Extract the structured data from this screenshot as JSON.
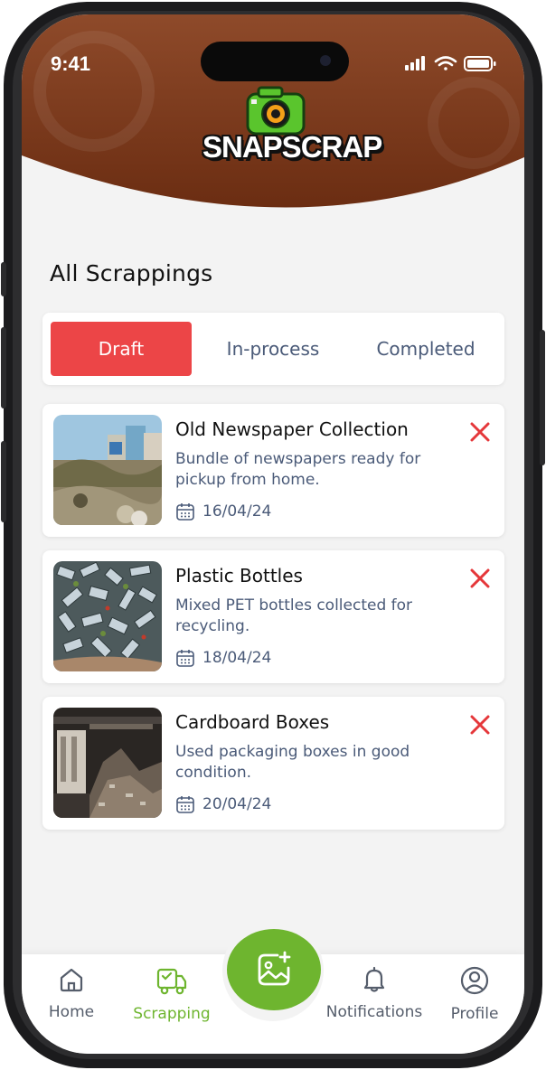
{
  "status_bar": {
    "time": "9:41"
  },
  "brand": {
    "logo_text": "SNAPSCRAP"
  },
  "page": {
    "title": "All Scrappings"
  },
  "tabs": [
    {
      "label": "Draft",
      "active": true
    },
    {
      "label": "In-process",
      "active": false
    },
    {
      "label": "Completed",
      "active": false
    }
  ],
  "scrappings": [
    {
      "title": "Old Newspaper Collection",
      "description": "Bundle of newspapers ready for pickup from home.",
      "date": "16/04/24"
    },
    {
      "title": "Plastic Bottles",
      "description": "Mixed PET bottles collected for recycling.",
      "date": "18/04/24"
    },
    {
      "title": "Cardboard Boxes",
      "description": "Used packaging boxes in good condition.",
      "date": "20/04/24"
    }
  ],
  "bottom_nav": [
    {
      "label": "Home",
      "icon": "home-icon",
      "active": false
    },
    {
      "label": "Scrapping",
      "icon": "truck-icon",
      "active": true
    },
    {
      "label": "Notifications",
      "icon": "bell-icon",
      "active": false
    },
    {
      "label": "Profile",
      "icon": "user-icon",
      "active": false
    }
  ],
  "colors": {
    "accent_red": "#ec4547",
    "accent_green": "#6eb52f",
    "header_brown": "#6b2d12",
    "text_muted": "#4a5a78"
  }
}
